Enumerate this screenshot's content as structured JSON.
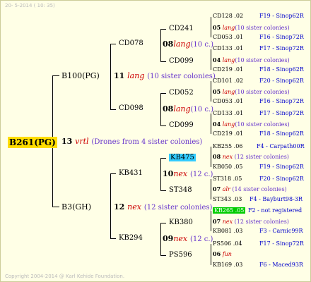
{
  "header": {
    "date": "20- 5-2014 ( 10: 35)"
  },
  "footer": {
    "copyright": "Copyright 2004-2014 @ Karl Kehide Foundation."
  },
  "root": {
    "label": "B261(PG)",
    "gen": "13",
    "breed": "vrtl",
    "siblings": "(Drones from 4 sister colonies)"
  },
  "level1": [
    {
      "label": "B100(PG)",
      "gen": "11",
      "breed": "lang",
      "siblings": "(10 sister colonies)"
    },
    {
      "label": "B3(GH)",
      "gen": "12",
      "breed": "nex",
      "siblings": "(12 sister colonies)"
    }
  ],
  "level2": [
    {
      "label": "CD078",
      "gen": "08",
      "breed": "lang",
      "siblings": "(10 c.)"
    },
    {
      "label": "CD098",
      "gen": "08",
      "breed": "lang",
      "siblings": "(10 c.)"
    },
    {
      "label": "KB431",
      "gen": "10",
      "breed": "nex",
      "siblings": "(12 c.)"
    },
    {
      "label": "KB294",
      "gen": "09",
      "breed": "nex",
      "siblings": "(12 c.)"
    }
  ],
  "level3": [
    {
      "label": "CD241",
      "gen": "05",
      "breed": "lang",
      "siblings": "(10 sister colonies)"
    },
    {
      "label": "CD099",
      "gen": "04",
      "breed": "lang",
      "siblings": "(10 sister colonies)"
    },
    {
      "label": "CD052",
      "gen": "05",
      "breed": "lang",
      "siblings": "(10 sister colonies)"
    },
    {
      "label": "CD099",
      "gen": "04",
      "breed": "lang",
      "siblings": "(10 sister colonies)"
    },
    {
      "label": "KB475",
      "gen": "08",
      "breed": "nex",
      "siblings": "(12 sister colonies)"
    },
    {
      "label": "ST348",
      "gen": "07",
      "breed": "alr",
      "siblings": "(14 sister colonies)"
    },
    {
      "label": "KB380",
      "gen": "07",
      "breed": "nex",
      "siblings": "(12 sister colonies)"
    },
    {
      "label": "PS596",
      "gen": "06",
      "breed": "fun",
      "siblings": ""
    }
  ],
  "level4": [
    {
      "name": "CD128",
      "num": ".02",
      "ref": "F19 - Sinop62R"
    },
    {
      "name": "CD053",
      "num": ".01",
      "ref": "F16 - Sinop72R"
    },
    {
      "name": "CD133",
      "num": ".01",
      "ref": "F17 - Sinop72R"
    },
    {
      "name": "CD219",
      "num": ".01",
      "ref": "F18 - Sinop62R"
    },
    {
      "name": "CD101",
      "num": ".02",
      "ref": "F20 - Sinop62R"
    },
    {
      "name": "CD053",
      "num": ".01",
      "ref": "F16 - Sinop72R"
    },
    {
      "name": "CD133",
      "num": ".01",
      "ref": "F17 - Sinop72R"
    },
    {
      "name": "CD219",
      "num": ".01",
      "ref": "F18 - Sinop62R"
    },
    {
      "name": "KB255",
      "num": ".06",
      "ref": "F4 - Carpath00R"
    },
    {
      "name": "KB050",
      "num": ".05",
      "ref": "F19 - Sinop62R"
    },
    {
      "name": "ST318",
      "num": ".05",
      "ref": "F20 - Sinop62R"
    },
    {
      "name": "ST343",
      "num": ".03",
      "ref": "F4 - Bayburt98-3R"
    },
    {
      "name": "KB265",
      "num": ".05",
      "ref": "F2 - not registered"
    },
    {
      "name": "KB081",
      "num": ".03",
      "ref": "F3 - Carnic99R"
    },
    {
      "name": "PS506",
      "num": ".04",
      "ref": "F17 - Sinop72R"
    },
    {
      "name": "KB169",
      "num": ".03",
      "ref": "F6 - Maced93R"
    }
  ],
  "colors": {
    "root_bg": "#ffdd00",
    "highlight_cyan": "#33ccff",
    "highlight_green": "#00cc00",
    "breed": "#cc0000",
    "sister": "#6633cc",
    "ref": "#0000cc"
  }
}
